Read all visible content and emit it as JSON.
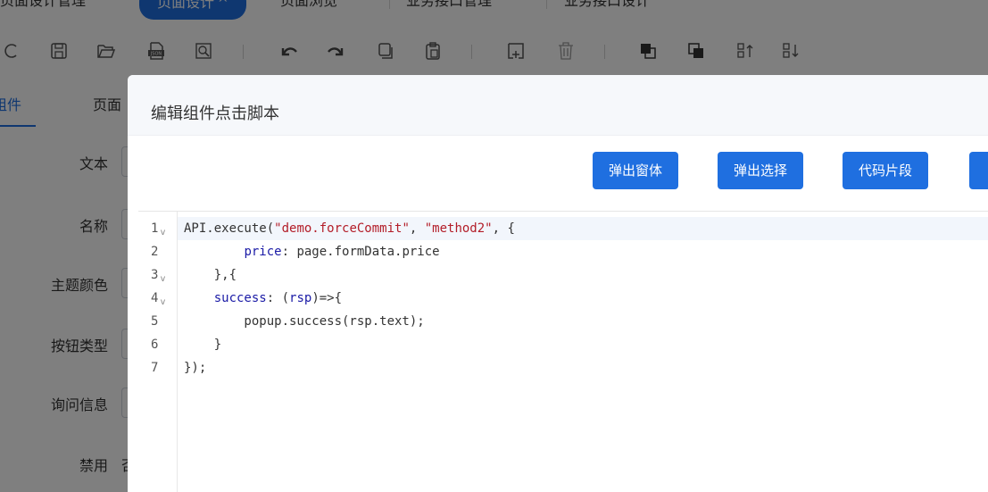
{
  "tabs": [
    {
      "label": "页面设计管理",
      "caret": "^"
    },
    {
      "label": "页面设计",
      "caret": "^",
      "active": true
    },
    {
      "label": "页面浏览",
      "caret": "^"
    },
    {
      "label": "业务接口管理",
      "caret": "^"
    },
    {
      "label": "业务接口设计",
      "caret": "^"
    }
  ],
  "toolbar": {
    "icons": [
      "refresh-icon",
      "save-icon",
      "folder-open-icon",
      "json-export-icon",
      "preview-icon",
      "undo-icon",
      "redo-icon",
      "copy-icon",
      "paste-icon",
      "add-container-icon",
      "delete-icon",
      "bring-front-icon",
      "send-back-icon",
      "sort-up-icon",
      "sort-down-icon"
    ]
  },
  "left_panel": {
    "tabs": [
      "组件",
      "页面"
    ],
    "fields": [
      {
        "label": "文本"
      },
      {
        "label": "名称"
      },
      {
        "label": "主题颜色"
      },
      {
        "label": "按钮类型"
      },
      {
        "label": "询问信息"
      },
      {
        "label": "禁用",
        "tail": "否"
      }
    ]
  },
  "dialog": {
    "title": "编辑组件点击脚本",
    "buttons": [
      "弹出窗体",
      "弹出选择",
      "代码片段",
      ""
    ],
    "accent": "#1f6fe0"
  },
  "editor": {
    "line_numbers": [
      "1",
      "2",
      "3",
      "4",
      "5",
      "6",
      "7"
    ],
    "fold_markers": [
      "v",
      "",
      "v",
      "v",
      "",
      "",
      ""
    ],
    "lines": [
      "API.execute(\"demo.forceCommit\", \"method2\", {",
      "        price: page.formData.price",
      "    },{",
      "    success: (rsp)=>{",
      "        popup.success(rsp.text);",
      "    }",
      "});"
    ]
  }
}
